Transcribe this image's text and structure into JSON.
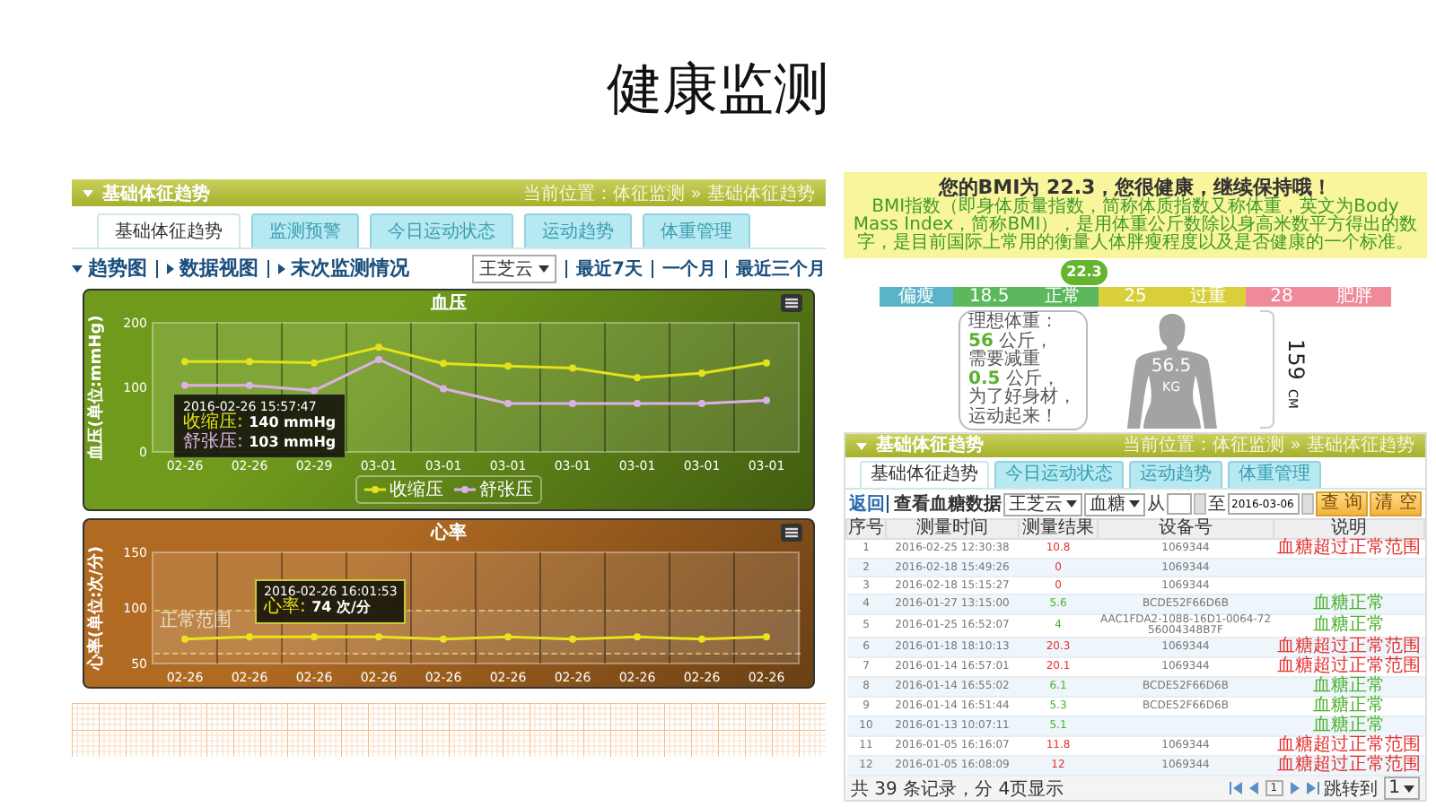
{
  "slide": {
    "title": "健康监测"
  },
  "trend_panel": {
    "header": {
      "title": "基础体征趋势",
      "breadcrumb": "当前位置：体征监测 » 基础体征趋势"
    },
    "tabs": [
      {
        "label": "基础体征趋势",
        "selected": true
      },
      {
        "label": "监测预警",
        "selected": false
      },
      {
        "label": "今日运动状态",
        "selected": false
      },
      {
        "label": "运动趋势",
        "selected": false
      },
      {
        "label": "体重管理",
        "selected": false
      }
    ],
    "views": [
      {
        "label": "趋势图",
        "expanded": true
      },
      {
        "label": "数据视图",
        "expanded": false
      },
      {
        "label": "末次监测情况",
        "expanded": false
      }
    ],
    "person_select": {
      "value": "王芝云"
    },
    "ranges": [
      "最近7天",
      "一个月",
      "最近三个月"
    ],
    "charts": [
      {
        "color": "#6f9a1c",
        "chart_data": {
          "type": "line",
          "title": "血压",
          "ylabel": "血压(单位:mmHg)",
          "legend": "bottom",
          "categories": [
            "02-26",
            "02-26",
            "02-29",
            "03-01",
            "03-01",
            "03-01",
            "03-01",
            "03-01",
            "03-01",
            "03-01"
          ],
          "ylim": [
            0,
            200
          ],
          "yticks": [
            0,
            100,
            200
          ],
          "series": [
            {
              "name": "收缩压",
              "color": "#e2e21a",
              "marker": "circle",
              "values": [
                140,
                140,
                138,
                162,
                137,
                133,
                130,
                115,
                122,
                138
              ]
            },
            {
              "name": "舒张压",
              "color": "#dcb0e6",
              "marker": "circle",
              "values": [
                103,
                103,
                95,
                143,
                98,
                75,
                75,
                75,
                75,
                80
              ]
            }
          ]
        },
        "tooltip": {
          "time": "2016-02-26 15:57:47",
          "lines": [
            {
              "label": "收缩压:",
              "value": "140 mmHg"
            },
            {
              "label": "舒张压:",
              "value": "103 mmHg"
            }
          ]
        }
      },
      {
        "color": "#b06a22",
        "band_label": "正常范围",
        "chart_data": {
          "type": "line",
          "title": "心率",
          "ylabel": "心率(单位:次/分)",
          "categories": [
            "02-26",
            "02-26",
            "02-26",
            "02-26",
            "02-26",
            "02-26",
            "02-26",
            "02-26",
            "02-26",
            "02-26"
          ],
          "ylim": [
            50,
            150
          ],
          "yticks": [
            50,
            100,
            150
          ],
          "series": [
            {
              "color": "#e8e41c",
              "marker": "circle",
              "values": [
                72,
                74,
                74,
                74,
                72,
                74,
                72,
                74,
                72,
                74
              ]
            }
          ]
        },
        "tooltip": {
          "time": "2016-02-26 16:01:53",
          "lines": [
            {
              "label": "心率:",
              "value": "74 次/分"
            }
          ]
        }
      }
    ]
  },
  "bmi_panel": {
    "headline": "您的BMI为 22.3，您很健康，继续保持哦！",
    "description": "BMI指数（即身体质量指数，简称体质指数又称体重，英文为Body Mass Index，简称BMI），是用体重公斤数除以身高米数平方得出的数字，是目前国际上常用的衡量人体胖瘦程度以及是否健康的一个标准。",
    "marker": {
      "value": "22.3",
      "level": 0.4
    },
    "scale": [
      {
        "label": "偏瘦",
        "color": "#5ab4c8"
      },
      {
        "label": "18.5",
        "color": "#5cb85c"
      },
      {
        "label": "正常",
        "color": "#5cb85c"
      },
      {
        "label": "25",
        "color": "#d9cf3a"
      },
      {
        "label": "过重",
        "color": "#d9cf3a"
      },
      {
        "label": "28",
        "color": "#ee8a9a"
      },
      {
        "label": "肥胖",
        "color": "#ee8a9a"
      }
    ],
    "tip_lines": [
      {
        "text": "理想体重："
      },
      {
        "number": "56",
        "text": "公斤，"
      },
      {
        "text": "需要减重"
      },
      {
        "number": "0.5",
        "text": "公斤，"
      },
      {
        "text": "为了好身材，"
      },
      {
        "text": "运动起来！"
      }
    ],
    "weight": {
      "value": "56.5",
      "unit": "KG"
    },
    "height": {
      "value": "159",
      "unit": "CM"
    }
  },
  "glucose_panel": {
    "header": {
      "title": "基础体征趋势",
      "breadcrumb": "当前位置：体征监测 » 基础体征趋势"
    },
    "tabs": [
      {
        "label": "基础体征趋势",
        "selected": true
      },
      {
        "label": "今日运动状态",
        "selected": false
      },
      {
        "label": "运动趋势",
        "selected": false
      },
      {
        "label": "体重管理",
        "selected": false
      }
    ],
    "back_link": "返回",
    "title": "查看血糖数据",
    "filters": {
      "person": "王芝云",
      "type": "血糖",
      "from_label": "从",
      "to_label": "至",
      "to_value": "2016-03-06"
    },
    "buttons": [
      "查 询",
      "清 空"
    ],
    "table": {
      "columns": [
        "序号",
        "测量时间",
        "测量结果",
        "设备号",
        "说明"
      ],
      "rows": [
        {
          "no": "1",
          "time": "2016-02-25 12:30:38",
          "result": "10.8",
          "device": "1069344",
          "note": "血糖超过正常范围",
          "kind": "abnormal"
        },
        {
          "no": "2",
          "time": "2016-02-18 15:49:26",
          "result": "0",
          "device": "1069344",
          "kind": "abnormal"
        },
        {
          "no": "3",
          "time": "2016-02-18 15:15:27",
          "result": "0",
          "device": "1069344",
          "kind": "abnormal"
        },
        {
          "no": "4",
          "time": "2016-01-27 13:15:00",
          "result": "5.6",
          "device": "BCDE52F66D6B",
          "note": "血糖正常",
          "kind": "normal"
        },
        {
          "no": "5",
          "time": "2016-01-25 16:52:07",
          "result": "4",
          "device": "AAC1FDA2-1088-16D1-0064-7256004348B7F",
          "note": "血糖正常",
          "kind": "normal"
        },
        {
          "no": "6",
          "time": "2016-01-18 18:10:13",
          "result": "20.3",
          "device": "1069344",
          "note": "血糖超过正常范围",
          "kind": "abnormal"
        },
        {
          "no": "7",
          "time": "2016-01-14 16:57:01",
          "result": "20.1",
          "device": "1069344",
          "note": "血糖超过正常范围",
          "kind": "abnormal"
        },
        {
          "no": "8",
          "time": "2016-01-14 16:55:02",
          "result": "6.1",
          "device": "BCDE52F66D6B",
          "note": "血糖正常",
          "kind": "normal"
        },
        {
          "no": "9",
          "time": "2016-01-14 16:51:44",
          "result": "5.3",
          "device": "BCDE52F66D6B",
          "note": "血糖正常",
          "kind": "normal"
        },
        {
          "no": "10",
          "time": "2016-01-13 10:07:11",
          "result": "5.1",
          "note": "血糖正常",
          "kind": "normal"
        },
        {
          "no": "11",
          "time": "2016-01-05 16:16:07",
          "result": "11.8",
          "device": "1069344",
          "note": "血糖超过正常范围",
          "kind": "abnormal"
        },
        {
          "no": "12",
          "time": "2016-01-05 16:08:09",
          "result": "12",
          "device": "1069344",
          "note": "血糖超过正常范围",
          "kind": "abnormal"
        }
      ]
    },
    "footer": {
      "summary": "共 39 条记录，分 4页显示",
      "page": "1",
      "jump_label": "跳转到",
      "jump_value": "1"
    }
  }
}
